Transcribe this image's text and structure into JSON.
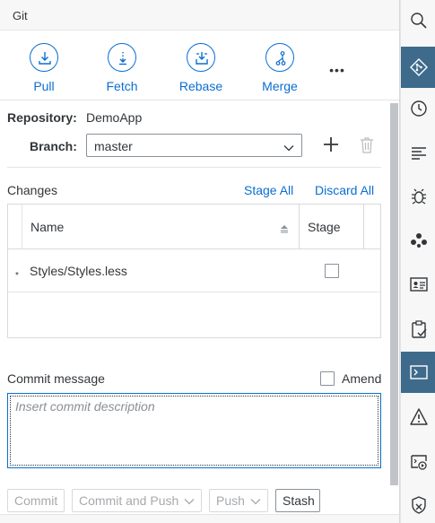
{
  "panel": {
    "title": "Git"
  },
  "toolbar": {
    "pull_label": "Pull",
    "fetch_label": "Fetch",
    "rebase_label": "Rebase",
    "merge_label": "Merge",
    "more_label": "•••"
  },
  "repository": {
    "label": "Repository:",
    "value": "DemoApp"
  },
  "branch": {
    "label": "Branch:",
    "value": "master"
  },
  "changes": {
    "label": "Changes",
    "stage_all": "Stage All",
    "discard_all": "Discard All",
    "columns": [
      "Name",
      "Stage"
    ],
    "rows": [
      {
        "marker": "*",
        "name": "Styles/Styles.less",
        "staged": false
      }
    ]
  },
  "commit": {
    "label": "Commit message",
    "amend_label": "Amend",
    "placeholder": "Insert commit description"
  },
  "actions": {
    "commit": "Commit",
    "commit_and_push": "Commit and Push",
    "push": "Push",
    "stash": "Stash"
  },
  "colors": {
    "accent": "#0a6ed1",
    "rail_active": "#3e6b8c"
  },
  "rail": [
    {
      "icon": "search-icon",
      "active": false
    },
    {
      "icon": "git-icon",
      "active": true
    },
    {
      "icon": "history-icon",
      "active": false
    },
    {
      "icon": "outline-icon",
      "active": false
    },
    {
      "icon": "debug-icon",
      "active": false
    },
    {
      "icon": "dependencies-icon",
      "active": false
    },
    {
      "icon": "profile-card-icon",
      "active": false
    },
    {
      "icon": "checklist-icon",
      "active": false
    },
    {
      "icon": "terminal-icon",
      "active": true
    },
    {
      "icon": "warning-icon",
      "active": false
    },
    {
      "icon": "run-console-icon",
      "active": false
    },
    {
      "icon": "security-icon",
      "active": false
    }
  ]
}
